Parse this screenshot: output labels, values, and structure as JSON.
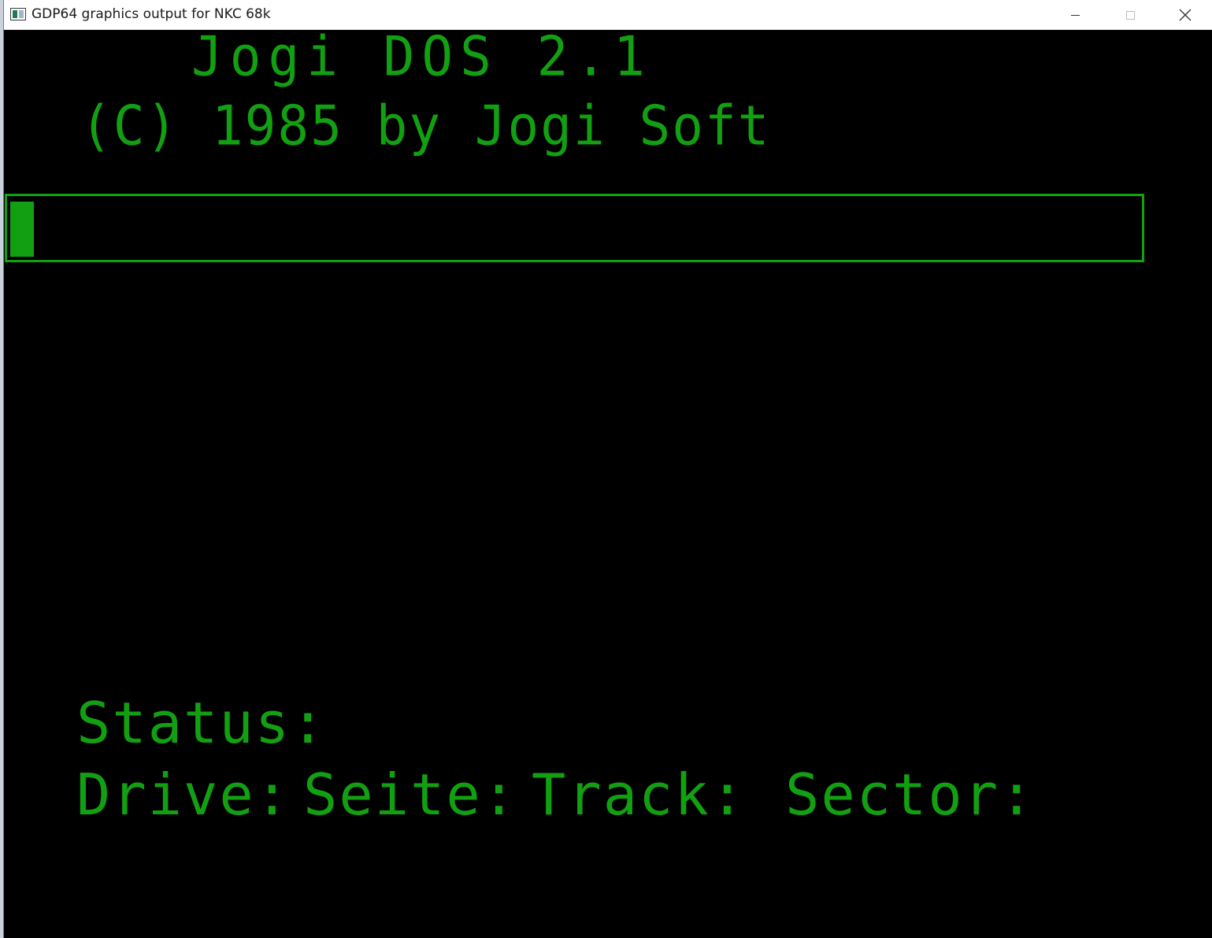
{
  "window": {
    "title": "GDP64 graphics output for NKC 68k",
    "icon": "app-window-icon",
    "controls": {
      "minimize_icon": "minimize-icon",
      "maximize_icon": "maximize-icon",
      "close_icon": "close-icon"
    }
  },
  "screen": {
    "os_title": "Jogi DOS 2.1",
    "copyright": "(C) 1985 by Jogi Soft",
    "input": {
      "value": ""
    },
    "status_label": "Status:",
    "fields": {
      "drive_label": "Drive:",
      "seite_label": "Seite:",
      "track_label": "Track:",
      "sector_label": "Sector:"
    }
  },
  "colors": {
    "phosphor_green": "#12a012",
    "background": "#000000",
    "titlebar": "#ffffff"
  }
}
